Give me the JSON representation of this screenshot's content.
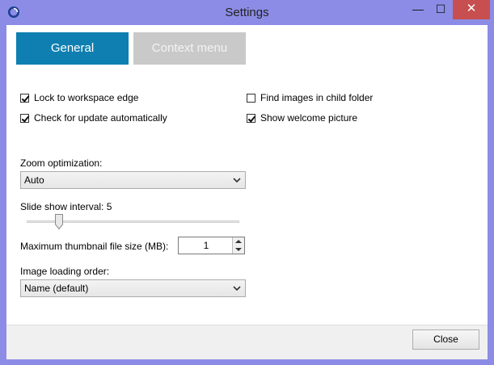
{
  "window": {
    "title": "Settings",
    "controls": {
      "minimize": "—",
      "maximize": "☐",
      "close": "✕"
    }
  },
  "tabs": [
    {
      "label": "General",
      "selected": true
    },
    {
      "label": "Context menu",
      "selected": false
    }
  ],
  "checkboxes": [
    {
      "label": "Lock to workspace edge",
      "checked": true
    },
    {
      "label": "Check for update automatically",
      "checked": true
    },
    {
      "label": "Find images in child folder",
      "checked": false
    },
    {
      "label": "Show welcome picture",
      "checked": true
    }
  ],
  "zoom": {
    "label": "Zoom optimization:",
    "value": "Auto"
  },
  "slideshow": {
    "label": "Slide show interval: 5",
    "value": 5
  },
  "thumbnail": {
    "label": "Maximum thumbnail file size (MB):",
    "value": "1"
  },
  "loading": {
    "label": "Image loading order:",
    "value": "Name (default)"
  },
  "footer": {
    "close_label": "Close"
  },
  "colors": {
    "accent": "#0f7fb1",
    "titlebar": "#8c8ce6",
    "close_hover": "#c74f4f"
  },
  "icons": {
    "app": "app-icon",
    "dropdown": "chevron-down-icon",
    "spin_up": "triangle-up-icon",
    "spin_down": "triangle-down-icon"
  }
}
